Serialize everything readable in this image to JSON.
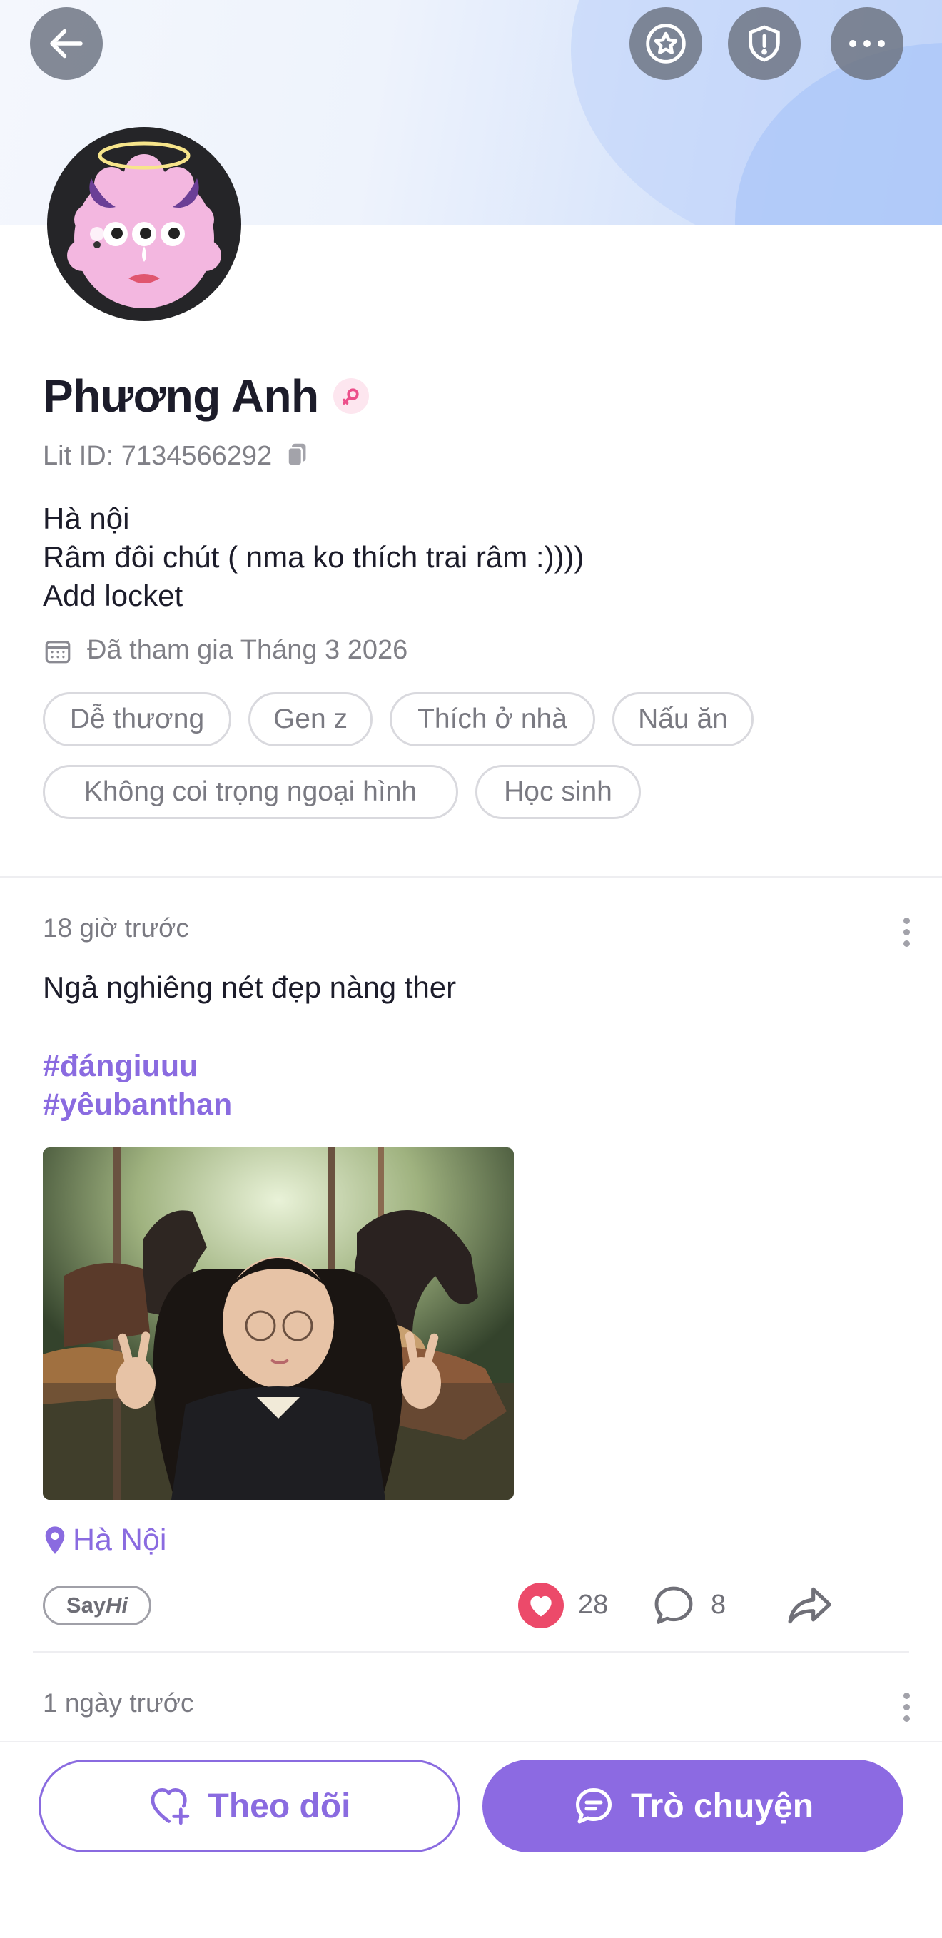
{
  "header": {
    "back_icon": "arrow-left-icon",
    "favorite_icon": "star-icon",
    "report_icon": "shield-alert-icon",
    "more_icon": "more-horizontal-icon"
  },
  "profile": {
    "name": "Phương Anh",
    "gender_icon": "female-symbol-icon",
    "lit_id": "Lit ID: 7134566292",
    "bio_lines": [
      "Hà nội",
      "Râm đôi chút ( nma ko thích trai râm :))))",
      "Add locket"
    ],
    "joined": "Đã tham gia Tháng 3 2026",
    "tags": [
      "Dễ thương",
      "Gen z",
      "Thích ở nhà",
      "Nấu ăn",
      "Không coi trọng ngoại hình",
      "Học sinh"
    ]
  },
  "post": {
    "time": "18 giờ trước",
    "text": "Ngả nghiêng nét đẹp nàng ther",
    "hashtags": [
      "#đángiuuu",
      "#yêubanthan"
    ],
    "location": "Hà Nội",
    "sayhi_say": "Say",
    "sayhi_hi": "Hi",
    "likes": "28",
    "comments": "8"
  },
  "next_post": {
    "time": "1 ngày trước"
  },
  "actions": {
    "follow_label": "Theo dõi",
    "chat_label": "Trò chuyện"
  },
  "colors": {
    "accent": "#8a6be0",
    "like": "#ec4a6a"
  }
}
